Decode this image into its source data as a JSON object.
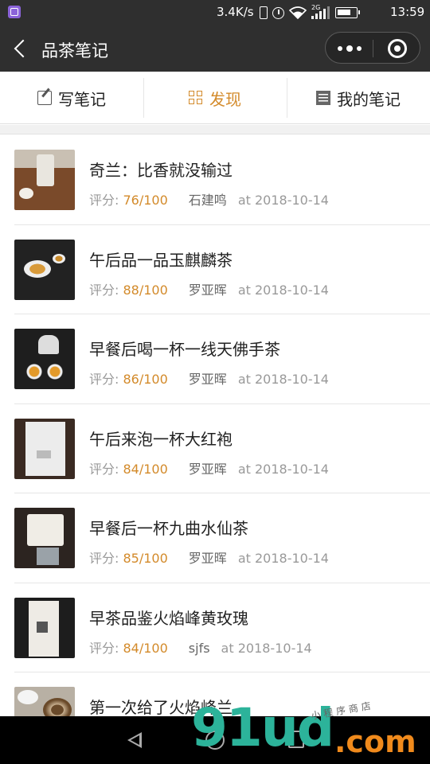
{
  "status_bar": {
    "net_speed": "3.4K/s",
    "signal_tag": "2G",
    "time": "13:59",
    "icons": [
      "vibrate-icon",
      "alarm-icon",
      "wifi-icon",
      "signal-icon",
      "battery-icon"
    ]
  },
  "title_bar": {
    "title": "品茶笔记",
    "icons": [
      "back-icon",
      "more-icon",
      "close-miniprogram-icon"
    ]
  },
  "tabs": [
    {
      "label": "写笔记",
      "icon": "pencil-icon",
      "active": false
    },
    {
      "label": "发现",
      "icon": "grid-icon",
      "active": true
    },
    {
      "label": "我的笔记",
      "icon": "list-icon",
      "active": false
    }
  ],
  "notes": [
    {
      "title": "奇兰：比香就没输过",
      "score_label": "评分:",
      "score": "76/100",
      "author": "石建鸣",
      "date": "at 2018-10-14"
    },
    {
      "title": "午后品一品玉麒麟茶",
      "score_label": "评分:",
      "score": "88/100",
      "author": "罗亚晖",
      "date": "at 2018-10-14"
    },
    {
      "title": "早餐后喝一杯一线天佛手茶",
      "score_label": "评分:",
      "score": "86/100",
      "author": "罗亚晖",
      "date": "at 2018-10-14"
    },
    {
      "title": "午后来泡一杯大红袍",
      "score_label": "评分:",
      "score": "84/100",
      "author": "罗亚晖",
      "date": "at 2018-10-14"
    },
    {
      "title": "早餐后一杯九曲水仙茶",
      "score_label": "评分:",
      "score": "85/100",
      "author": "罗亚晖",
      "date": "at 2018-10-14"
    },
    {
      "title": "早茶品鉴火焰峰黄玫瑰",
      "score_label": "评分:",
      "score": "84/100",
      "author": "sjfs",
      "date": "at 2018-10-14"
    },
    {
      "title": "第一次给了火焰峰兰",
      "score_label": "",
      "score": "",
      "author": "",
      "date": ""
    }
  ],
  "watermark": {
    "main": "91ud",
    "suffix": ".com",
    "sub": "小程序商店"
  },
  "colors": {
    "accent": "#d38a2a",
    "bar": "#2f2f2f"
  }
}
